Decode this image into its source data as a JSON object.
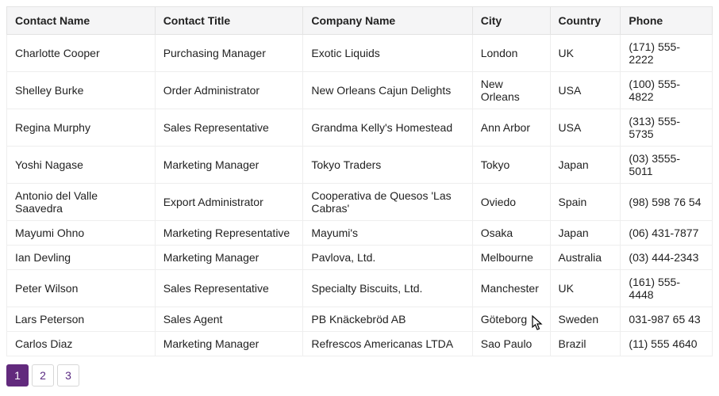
{
  "headers": {
    "contactName": "Contact Name",
    "contactTitle": "Contact Title",
    "companyName": "Company Name",
    "city": "City",
    "country": "Country",
    "phone": "Phone"
  },
  "rows": [
    {
      "contactName": "Charlotte Cooper",
      "contactTitle": "Purchasing Manager",
      "companyName": "Exotic Liquids",
      "city": "London",
      "country": "UK",
      "phone": "(171) 555-2222"
    },
    {
      "contactName": "Shelley Burke",
      "contactTitle": "Order Administrator",
      "companyName": "New Orleans Cajun Delights",
      "city": "New Orleans",
      "country": "USA",
      "phone": "(100) 555-4822"
    },
    {
      "contactName": "Regina Murphy",
      "contactTitle": "Sales Representative",
      "companyName": "Grandma Kelly's Homestead",
      "city": "Ann Arbor",
      "country": "USA",
      "phone": "(313) 555-5735"
    },
    {
      "contactName": "Yoshi Nagase",
      "contactTitle": "Marketing Manager",
      "companyName": "Tokyo Traders",
      "city": "Tokyo",
      "country": "Japan",
      "phone": "(03) 3555-5011"
    },
    {
      "contactName": "Antonio del Valle Saavedra",
      "contactTitle": "Export Administrator",
      "companyName": "Cooperativa de Quesos 'Las Cabras'",
      "city": "Oviedo",
      "country": "Spain",
      "phone": "(98) 598 76 54"
    },
    {
      "contactName": "Mayumi Ohno",
      "contactTitle": "Marketing Representative",
      "companyName": "Mayumi's",
      "city": "Osaka",
      "country": "Japan",
      "phone": "(06) 431-7877"
    },
    {
      "contactName": "Ian Devling",
      "contactTitle": "Marketing Manager",
      "companyName": "Pavlova, Ltd.",
      "city": "Melbourne",
      "country": "Australia",
      "phone": "(03) 444-2343"
    },
    {
      "contactName": "Peter Wilson",
      "contactTitle": "Sales Representative",
      "companyName": "Specialty Biscuits, Ltd.",
      "city": "Manchester",
      "country": "UK",
      "phone": "(161) 555-4448"
    },
    {
      "contactName": "Lars Peterson",
      "contactTitle": "Sales Agent",
      "companyName": "PB Knäckebröd AB",
      "city": "Göteborg",
      "country": "Sweden",
      "phone": "031-987 65 43"
    },
    {
      "contactName": "Carlos Diaz",
      "contactTitle": "Marketing Manager",
      "companyName": "Refrescos Americanas LTDA",
      "city": "Sao Paulo",
      "country": "Brazil",
      "phone": "(11) 555 4640"
    }
  ],
  "pager": {
    "current": 1,
    "pages": [
      "1",
      "2",
      "3"
    ]
  }
}
